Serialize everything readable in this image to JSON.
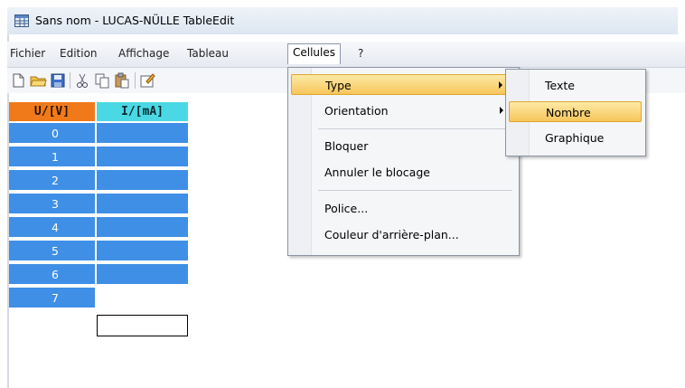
{
  "window": {
    "title": "Sans nom - LUCAS-NÜLLE TableEdit"
  },
  "menubar": {
    "items": [
      "Fichier",
      "Edition",
      "Affichage",
      "Tableau",
      "Cellules",
      "?"
    ]
  },
  "toolbar": {
    "buttons": [
      "new-file-icon",
      "open-folder-icon",
      "save-icon",
      "cut-icon",
      "copy-icon",
      "paste-icon",
      "properties-icon"
    ]
  },
  "table": {
    "headers": [
      "U/[V]",
      "I/[mA]"
    ],
    "header_colors": [
      "#f07a1a",
      "#4ad8e4"
    ],
    "row_color": "#3f8fe6",
    "rows": [
      "0",
      "1",
      "2",
      "3",
      "4",
      "5",
      "6",
      "7"
    ]
  },
  "cellules_menu": {
    "items": [
      "Type",
      "Orientation",
      "Bloquer",
      "Annuler le blocage",
      "Police...",
      "Couleur d'arrière-plan..."
    ],
    "highlighted": "Type"
  },
  "type_submenu": {
    "items": [
      "Texte",
      "Nombre",
      "Graphique"
    ],
    "highlighted": "Nombre"
  }
}
